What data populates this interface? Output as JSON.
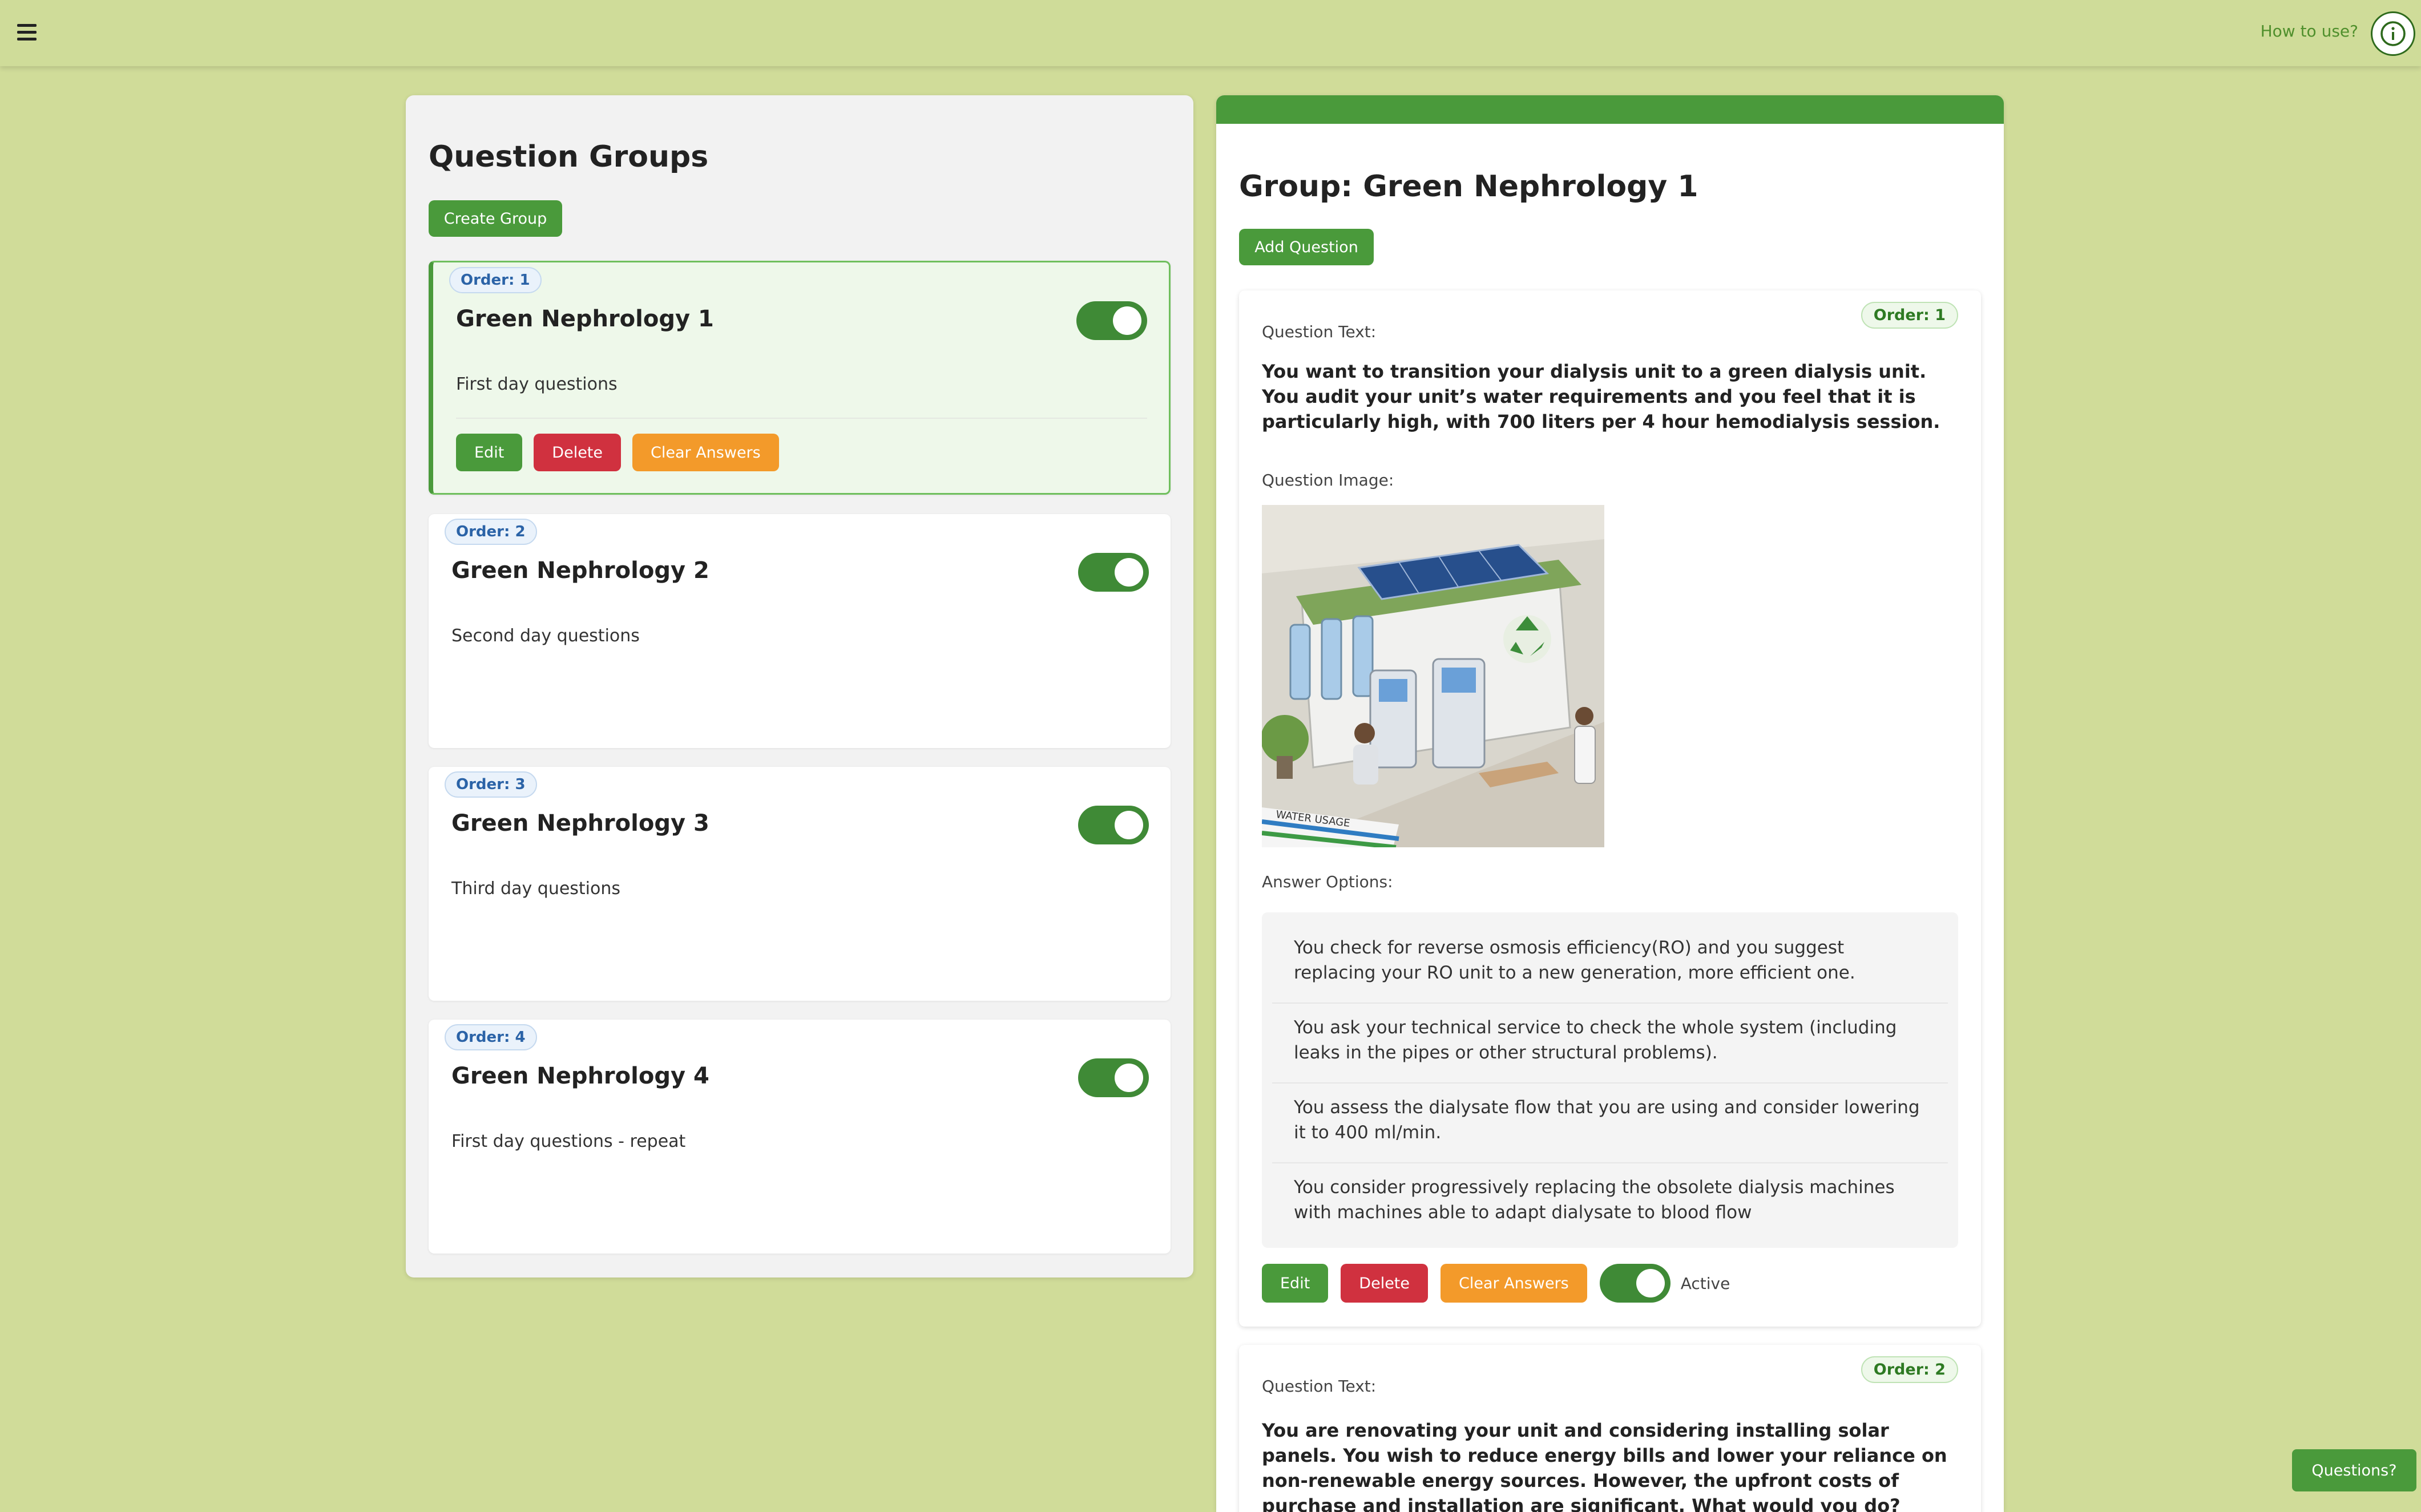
{
  "header": {
    "menu_icon": "hamburger-menu-icon",
    "help_link": "How to use?",
    "info_icon": "info-circle-icon"
  },
  "groups_panel": {
    "title": "Question Groups",
    "create_button": "Create Group",
    "groups": [
      {
        "order": "Order: 1",
        "name": "Green Nephrology 1",
        "description": "First day questions",
        "active": true,
        "selected": true,
        "edit_label": "Edit",
        "delete_label": "Delete",
        "clear_label": "Clear Answers"
      },
      {
        "order": "Order: 2",
        "name": "Green Nephrology 2",
        "description": "Second day questions",
        "active": true,
        "selected": false
      },
      {
        "order": "Order: 3",
        "name": "Green Nephrology 3",
        "description": "Third day questions",
        "active": true,
        "selected": false
      },
      {
        "order": "Order: 4",
        "name": "Green Nephrology 4",
        "description": "First day questions - repeat",
        "active": true,
        "selected": false
      }
    ]
  },
  "group_detail": {
    "title": "Group: Green Nephrology 1",
    "add_question_button": "Add Question",
    "questions": [
      {
        "order": "Order: 1",
        "text_label": "Question Text:",
        "text": "You want to transition your dialysis unit to a green dialysis unit. You audit your unit’s water requirements and you feel that it is particularly high, with 700 liters per 4 hour hemodialysis session.",
        "image_label": "Question Image:",
        "image_caption": "WATER USAGE",
        "options_label": "Answer Options:",
        "options": [
          "You check for reverse osmosis efficiency(RO) and you suggest replacing your RO unit to a new generation, more efficient one.",
          "You ask your technical service to check the whole system (including leaks in the pipes or other structural problems).",
          "You assess the dialysate flow that you are using and consider lowering it to 400 ml/min.",
          "You consider progressively replacing the obsolete dialysis machines with machines able to adapt dialysate to blood flow"
        ],
        "edit_label": "Edit",
        "delete_label": "Delete",
        "clear_label": "Clear Answers",
        "active_label": "Active"
      },
      {
        "order": "Order: 2",
        "text_label": "Question Text:",
        "text": "You are renovating your unit and considering installing solar panels. You wish to reduce energy bills and lower your reliance on non-renewable energy sources. However, the upfront costs of purchase and installation are significant. What would you do?"
      }
    ]
  },
  "floating": {
    "questions_button": "Questions?"
  },
  "colors": {
    "page_bg": "#d0dc99",
    "accent_green": "#4a9a3b",
    "danger_red": "#d0313f",
    "warning_orange": "#f39a2a"
  }
}
